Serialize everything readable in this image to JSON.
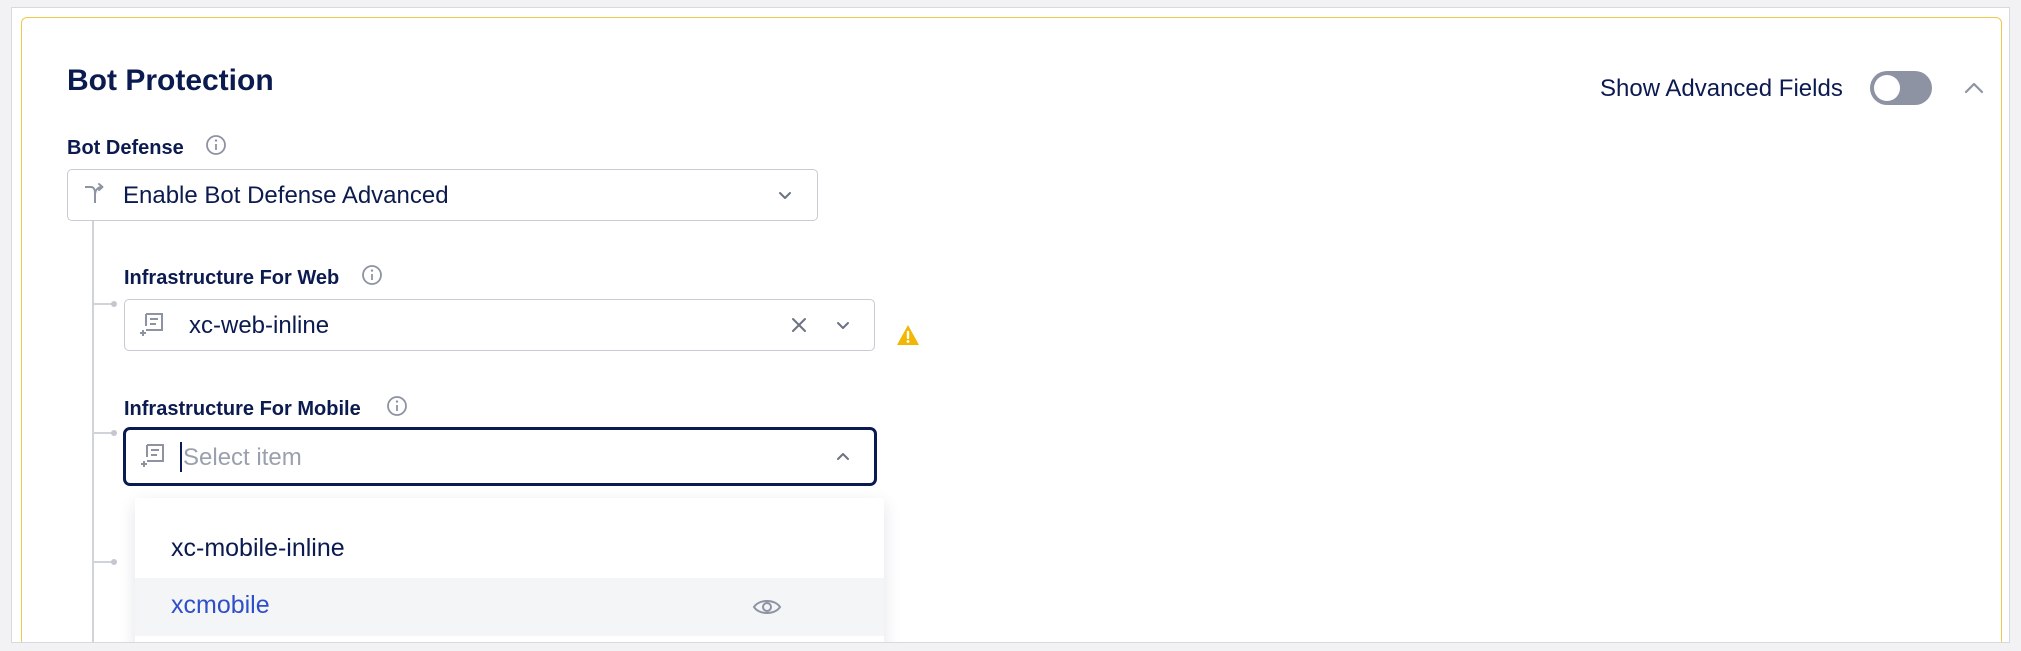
{
  "section": {
    "title": "Bot Protection",
    "advanced_label": "Show Advanced Fields",
    "advanced_enabled": false
  },
  "bot_defense": {
    "label": "Bot Defense",
    "value": "Enable Bot Defense Advanced"
  },
  "infra_web": {
    "label": "Infrastructure For Web",
    "value": "xc-web-inline"
  },
  "infra_mobile": {
    "label": "Infrastructure For Mobile",
    "placeholder": "Select item",
    "options": [
      "xc-mobile-inline",
      "xcmobile"
    ]
  },
  "colors": {
    "navy": "#0b1a4f",
    "accent_link": "#2f4fc9",
    "warning": "#f2b705",
    "card_border": "#f0c94a"
  }
}
